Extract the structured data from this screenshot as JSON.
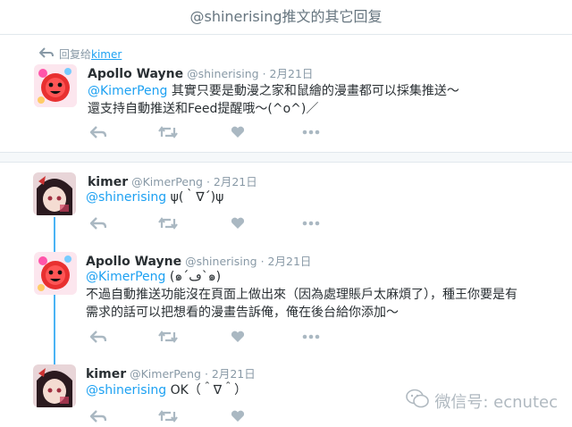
{
  "header": {
    "title": "@shinerising推文的其它回复"
  },
  "reply_context": {
    "prefix": "回复给",
    "target": "kimer"
  },
  "tweets": [
    {
      "name": "Apollo Wayne",
      "handle": "@shinerising",
      "date": "· 2月21日",
      "mention": "@KimerPeng",
      "line1": " 其實只要是動漫之家和鼠繪的漫畫都可以採集推送～",
      "line2": "還支持自動推送和Feed提醒哦～(^o^)／"
    },
    {
      "name": "kimer",
      "handle": "@KimerPeng",
      "date": "· 2月21日",
      "mention": "@shinerising",
      "line1": " ψ(｀∇´)ψ"
    },
    {
      "name": "Apollo Wayne",
      "handle": "@shinerising",
      "date": "· 2月21日",
      "mention": "@KimerPeng",
      "line1": " (๑´ڡ`๑)",
      "line2": "不過自動推送功能沒在頁面上做出來（因為處理賬戶太麻煩了），種王你要是有",
      "line3": "需求的話可以把想看的漫畫告訴俺，俺在後台給你添加～"
    },
    {
      "name": "kimer",
      "handle": "@KimerPeng",
      "date": "· 2月21日",
      "mention": "@shinerising",
      "line1": " OK（＾∇＾）"
    }
  ],
  "watermark": {
    "text": "微信号: ecnutec"
  },
  "colors": {
    "accent": "#1da1f2",
    "muted": "#8899a6",
    "thread": "#4ab3f4"
  }
}
